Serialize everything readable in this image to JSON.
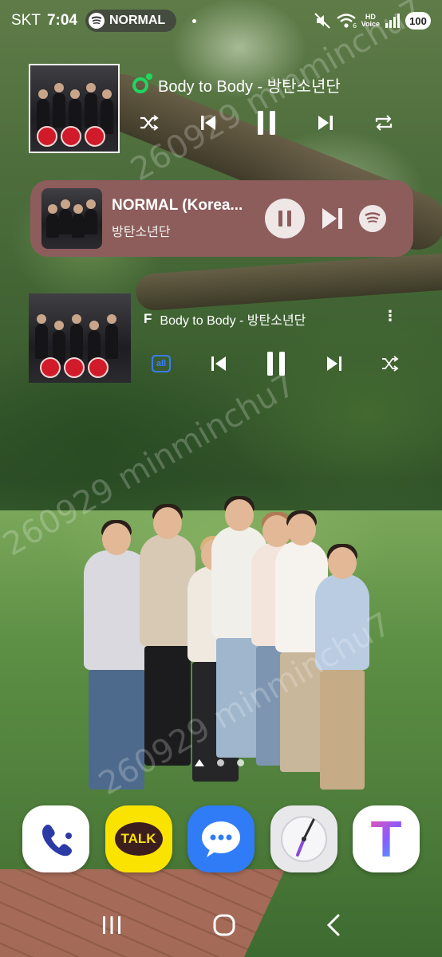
{
  "status_bar": {
    "carrier": "SKT",
    "time": "7:04",
    "now_playing_pill": "NORMAL",
    "hd_top": "HD",
    "hd_bottom": "Voice",
    "wifi_sub": "6",
    "battery": "100"
  },
  "widget_top": {
    "title": "Body to Body - 방탄소년단",
    "controls": [
      "shuffle-icon",
      "previous-icon",
      "pause-icon",
      "next-icon",
      "repeat-icon"
    ]
  },
  "spotify_card": {
    "title": "NORMAL (Korea...",
    "artist": "방탄소년단",
    "bg_color": "#8c5d5b",
    "controls": [
      "pause-icon",
      "next-icon",
      "spotify-icon"
    ]
  },
  "widget_bottom": {
    "app_glyph": "F",
    "title": "Body to Body - 방탄소년단",
    "more": "⋮",
    "repeat_badge": "all",
    "accent": "#3b7cff"
  },
  "watermark": "260929 minminchu7",
  "page_indicator": {
    "pages": 3,
    "current": 0
  },
  "dock": {
    "apps": [
      {
        "name": "Phone",
        "icon": "phone-icon"
      },
      {
        "name": "KakaoTalk",
        "label": "TALK",
        "icon": "kakaotalk-icon"
      },
      {
        "name": "Messages",
        "icon": "messages-icon"
      },
      {
        "name": "Clock",
        "icon": "clock-icon"
      },
      {
        "name": "T",
        "label": "T",
        "icon": "t-app-icon"
      }
    ]
  },
  "navbar": [
    "recents-icon",
    "home-icon",
    "back-icon"
  ]
}
